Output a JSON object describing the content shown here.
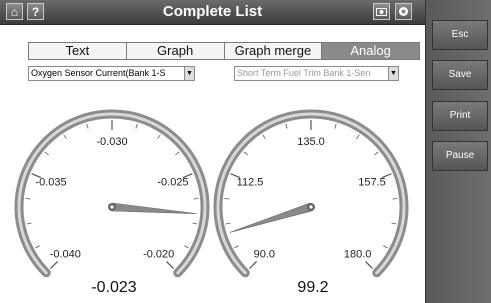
{
  "header": {
    "title": "Complete List",
    "icons": [
      "home-icon",
      "help-icon",
      "camera-icon",
      "record-icon"
    ]
  },
  "tabs": [
    {
      "label": "Text",
      "active": false
    },
    {
      "label": "Graph",
      "active": false
    },
    {
      "label": "Graph merge",
      "active": false
    },
    {
      "label": "Analog",
      "active": true
    }
  ],
  "selects": {
    "left": {
      "value": "Oxygen Sensor Current(Bank 1-S"
    },
    "right": {
      "value": "Short Term Fuel Trim Bank 1-Sen"
    }
  },
  "gauges": [
    {
      "name": "oxygen-sensor-gauge",
      "labels": [
        "-0.040",
        "-0.035",
        "-0.030",
        "-0.025",
        "-0.020"
      ],
      "min": -0.04,
      "max": -0.02,
      "value": -0.023,
      "readout": "-0.023"
    },
    {
      "name": "fuel-trim-gauge",
      "labels": [
        "90.0",
        "112.5",
        "135.0",
        "157.5",
        "180.0"
      ],
      "min": 90.0,
      "max": 180.0,
      "value": 99.2,
      "readout": "99.2"
    }
  ],
  "side_buttons": [
    "Esc",
    "Save",
    "Print",
    "Pause"
  ]
}
